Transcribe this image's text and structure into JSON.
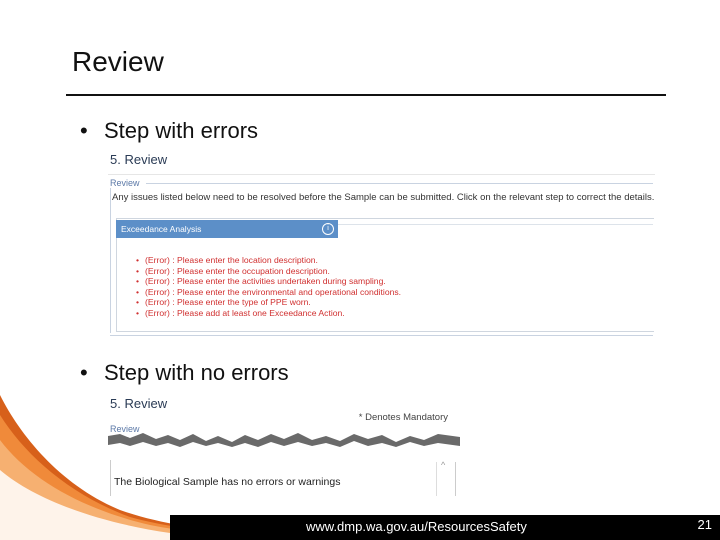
{
  "slide": {
    "title": "Review",
    "bullets": [
      "Step with errors",
      "Step with no errors"
    ],
    "bullet_glyph": "•"
  },
  "screenshot_errors": {
    "heading": "5. Review",
    "legend": "Review",
    "issues_text": "Any issues listed below need to be resolved before the Sample can be submitted. Click on the relevant step to correct the details.",
    "tab_title": "Exceedance Analysis",
    "info_glyph": "i",
    "errors": [
      "(Error) : Please enter the location description.",
      "(Error) : Please enter the occupation description.",
      "(Error) : Please enter the activities undertaken during sampling.",
      "(Error) : Please enter the environmental and operational conditions.",
      "(Error) : Please enter the type of PPE worn.",
      "(Error) : Please add at least one Exceedance Action."
    ]
  },
  "screenshot_no_errors": {
    "heading": "5. Review",
    "mandatory_note": "* Denotes Mandatory",
    "legend": "Review",
    "message": "The Biological Sample has no errors or warnings"
  },
  "footer": {
    "url": "www.dmp.wa.gov.au/ResourcesSafety",
    "page_number": "21"
  },
  "colors": {
    "error": "#d03030",
    "tab_bg": "#5c8fc8",
    "footer_bg": "#000000",
    "swoosh": "#d7601a"
  }
}
